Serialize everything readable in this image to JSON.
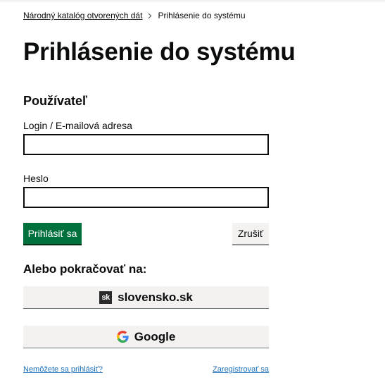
{
  "breadcrumb": {
    "home": "Národný katalóg otvorených dát",
    "current": "Prihlásenie do systému"
  },
  "page_title": "Prihlásenie do systému",
  "form": {
    "section_title": "Používateľ",
    "login_label": "Login / E-mailová adresa",
    "login_value": "",
    "password_label": "Heslo",
    "password_value": "",
    "submit_label": "Prihlásiť sa",
    "cancel_label": "Zrušiť"
  },
  "alternatives": {
    "title": "Alebo pokračovať na:",
    "providers": [
      {
        "label": "slovensko.sk",
        "icon": "slovensko-sk-logo-icon",
        "logo_text": "sk"
      },
      {
        "label": "Google",
        "icon": "google-logo-icon"
      }
    ]
  },
  "links": {
    "forgot": "Nemôžete sa prihlásiť?",
    "register": "Zaregistrovať sa"
  },
  "colors": {
    "primary": "#00703c",
    "link": "#1d70b8",
    "text": "#0b0c0c",
    "secondary_bg": "#f3f2f1"
  }
}
